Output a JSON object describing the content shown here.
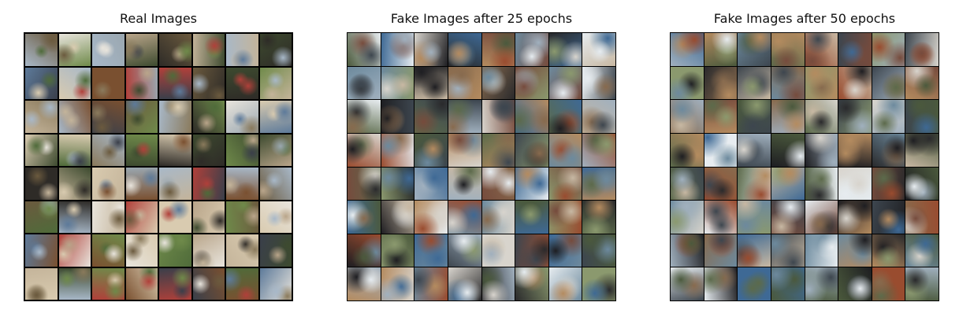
{
  "panels": [
    {
      "id": "real",
      "title": "Real Images"
    },
    {
      "id": "fake25",
      "title": "Fake Images after 25 epochs"
    },
    {
      "id": "fake50",
      "title": "Fake Images after 50 epochs"
    }
  ],
  "grid": {
    "rows": 8,
    "cols": 8
  }
}
